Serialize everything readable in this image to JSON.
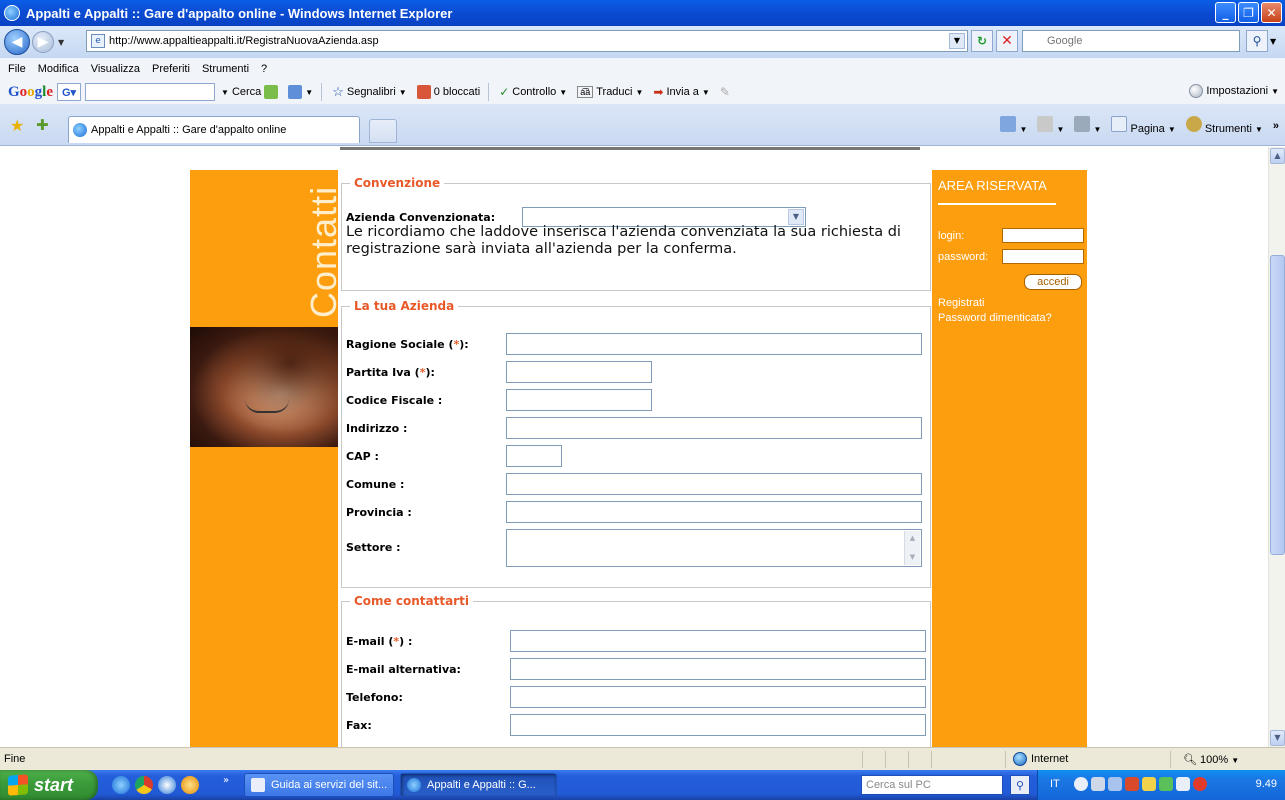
{
  "window": {
    "title": "Appalti e Appalti :: Gare d'appalto online - Windows Internet Explorer",
    "buttons": [
      "minimize",
      "maximize",
      "close"
    ]
  },
  "address": {
    "url": "http://www.appaltieappalti.it/RegistraNuovaAzienda.asp",
    "search_placeholder": "Google"
  },
  "menu": {
    "items": [
      "File",
      "Modifica",
      "Visualizza",
      "Preferiti",
      "Strumenti",
      "?"
    ]
  },
  "google_toolbar": {
    "cerca": "Cerca",
    "segnalibri": "Segnalibri",
    "bloccati": "0 bloccati",
    "controllo": "Controllo",
    "traduci": "Traduci",
    "invia": "Invia a",
    "impostazioni": "Impostazioni"
  },
  "tabs": {
    "active_label": "Appalti e Appalti :: Gare d'appalto online"
  },
  "command_bar": {
    "pagina": "Pagina",
    "strumenti": "Strumenti"
  },
  "left_banner": {
    "vertical_text": "Contatti"
  },
  "right_banner": {
    "title": "AREA RISERVATA",
    "login_label": "login:",
    "password_label": "password:",
    "login_button": "accedi",
    "register_link": "Registrati",
    "forgot_link": "Password dimenticata?"
  },
  "convenzione": {
    "legend": "Convenzione",
    "azienda_label": "Azienda Convenzionata:",
    "notice": "Le ricordiamo che laddove inserisca l'azienda convenziata la sua richiesta di registrazione sarà inviata all'azienda per la conferma."
  },
  "azienda": {
    "legend": "La tua Azienda",
    "fields": {
      "ragione_sociale": "Ragione Sociale (*):",
      "partita_iva": "Partita Iva (*):",
      "codice_fiscale": "Codice Fiscale :",
      "indirizzo": "Indirizzo :",
      "cap": "CAP :",
      "comune": "Comune :",
      "provincia": "Provincia :",
      "settore": "Settore :"
    }
  },
  "contatti": {
    "legend": "Come contattarti",
    "fields": {
      "email": "E-mail (*) :",
      "email_alt": "E-mail alternativa:",
      "telefono": "Telefono:",
      "fax": "Fax:"
    }
  },
  "status": {
    "text": "Fine",
    "zone": "Internet",
    "zoom": "100%"
  },
  "taskbar": {
    "start": "start",
    "tasks": [
      "Guida ai servizi del sit...",
      "Appalti e Appalti :: G..."
    ],
    "desktop_search_placeholder": "Cerca sul PC",
    "language": "IT",
    "clock": "9.49"
  },
  "colors": {
    "orange": "#fd9e0f",
    "legend_red": "#e8592a",
    "xp_blue": "#245edb"
  }
}
